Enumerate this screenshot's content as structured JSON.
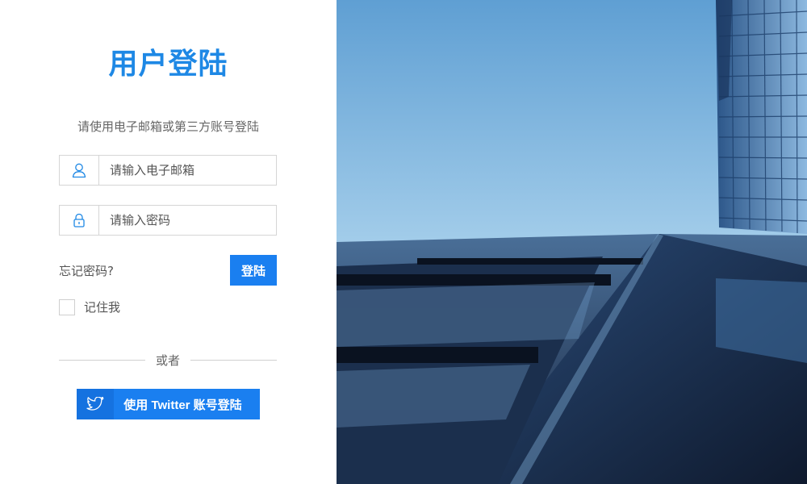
{
  "login": {
    "title": "用户登陆",
    "subtitle": "请使用电子邮箱或第三方账号登陆",
    "email_placeholder": "请输入电子邮箱",
    "password_placeholder": "请输入密码",
    "forgot_label": "忘记密码?",
    "login_button": "登陆",
    "remember_label": "记住我",
    "divider_text": "或者",
    "twitter_button": "使用 Twitter 账号登陆",
    "icons": {
      "email": "user-icon",
      "password": "lock-icon",
      "twitter": "twitter-icon"
    }
  },
  "colors": {
    "accent": "#1e88e5",
    "button": "#1a7ff0",
    "sky_top": "#6aa8d8",
    "sky_bottom": "#b9dcef"
  }
}
